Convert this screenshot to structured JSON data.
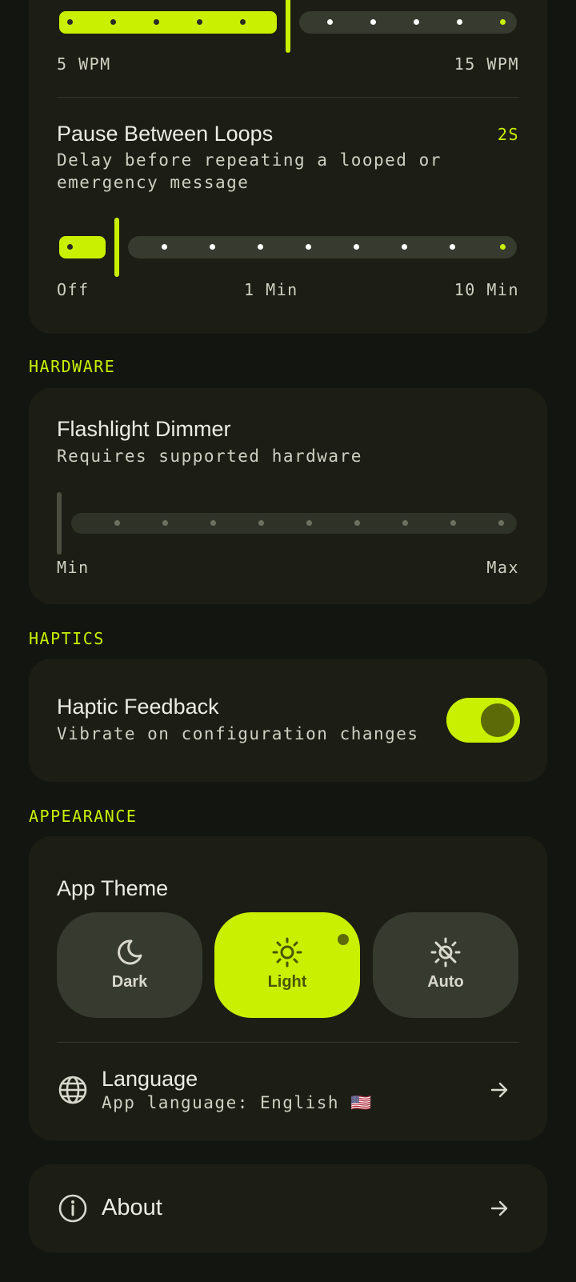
{
  "speed_card": {
    "min_label": "5 WPM",
    "max_label": "15 WPM",
    "value_fraction": 0.5
  },
  "pause_card": {
    "title": "Pause Between Loops",
    "value": "2S",
    "description": "Delay before repeating a looped or emergency message",
    "labels": {
      "off": "Off",
      "mid": "1 Min",
      "max": "10 Min"
    }
  },
  "hardware": {
    "section_title": "HARDWARE",
    "title": "Flashlight Dimmer",
    "description": "Requires supported hardware",
    "min_label": "Min",
    "max_label": "Max",
    "enabled": false
  },
  "haptics": {
    "section_title": "HAPTICS",
    "title": "Haptic Feedback",
    "description": "Vibrate on configuration changes",
    "enabled": true
  },
  "appearance": {
    "section_title": "APPEARANCE",
    "theme_title": "App Theme",
    "themes": [
      {
        "label": "Dark",
        "icon": "moon-icon",
        "selected": false
      },
      {
        "label": "Light",
        "icon": "sun-icon",
        "selected": true
      },
      {
        "label": "Auto",
        "icon": "auto-brightness-icon",
        "selected": false
      }
    ],
    "language": {
      "title": "Language",
      "subtitle": "App language: English 🇺🇸",
      "icon": "globe-icon"
    }
  },
  "about": {
    "title": "About",
    "icon": "info-icon"
  },
  "colors": {
    "accent": "#c8f000",
    "background": "#131510",
    "card": "#1c1e15"
  }
}
